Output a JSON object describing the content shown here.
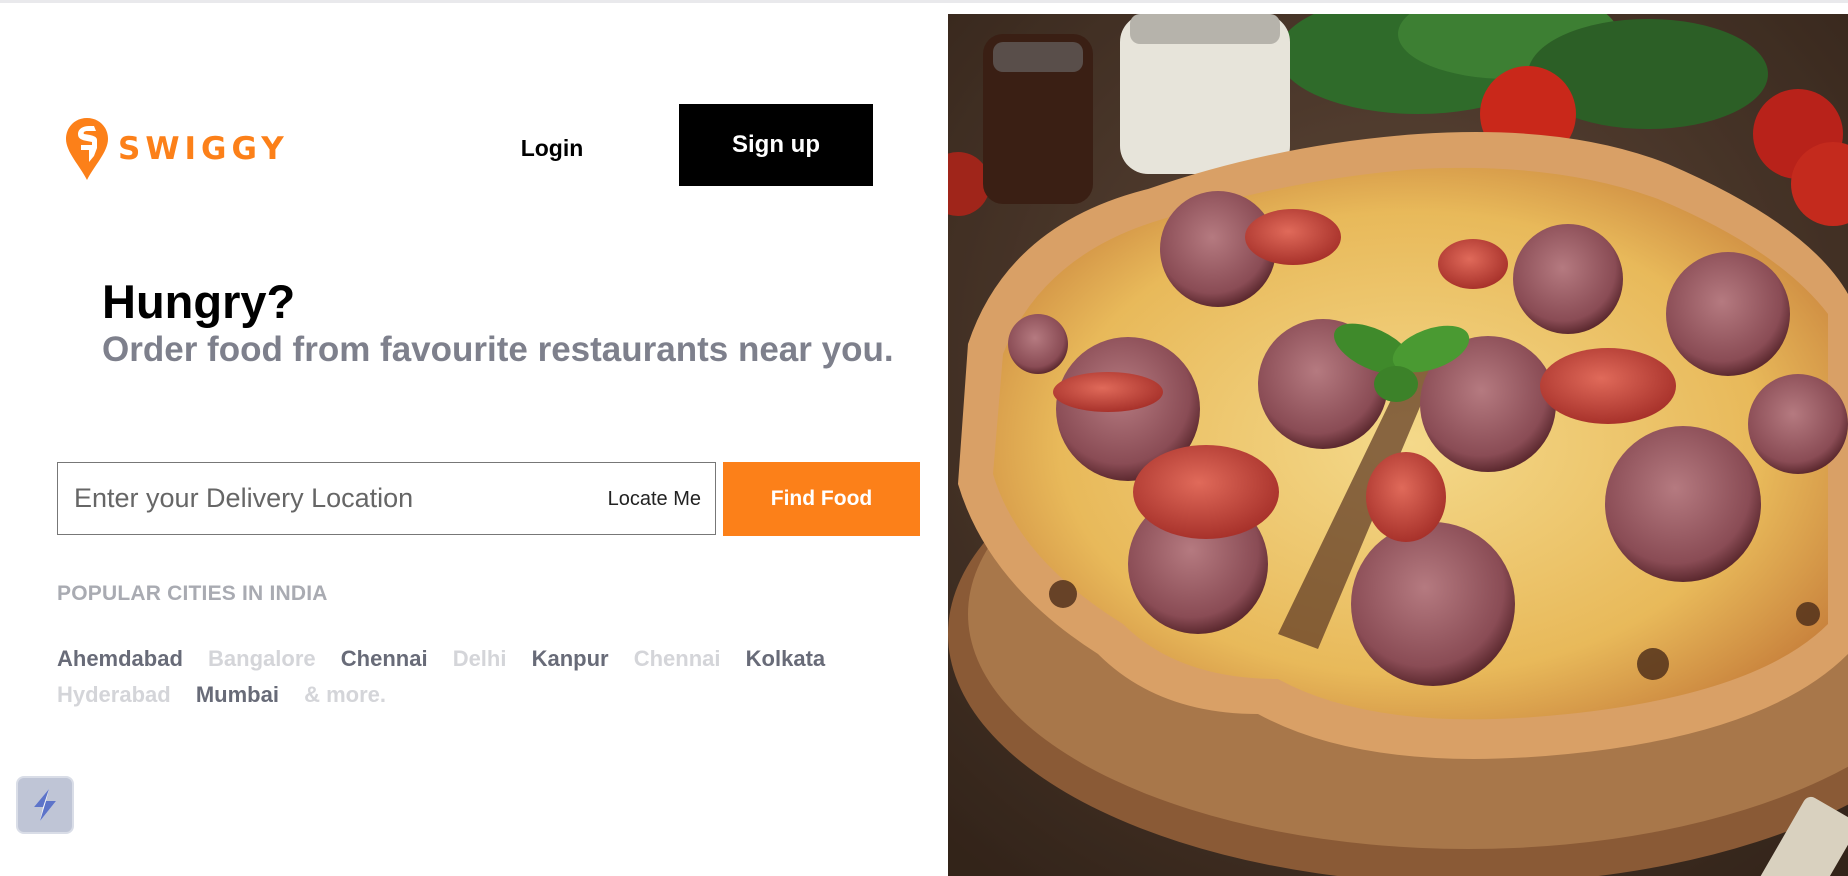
{
  "brand": {
    "name": "SWIGGY",
    "color": "#fc8019"
  },
  "header": {
    "login_label": "Login",
    "signup_label": "Sign up"
  },
  "hero_text": {
    "headline": "Hungry?",
    "subline": "Order food from favourite restaurants near you."
  },
  "search": {
    "placeholder": "Enter your Delivery Location",
    "value": "",
    "locate_label": "Locate Me",
    "submit_label": "Find Food"
  },
  "popular": {
    "title": "POPULAR CITIES IN INDIA",
    "cities": [
      {
        "name": "Ahemdabad",
        "tone": "dark"
      },
      {
        "name": "Bangalore",
        "tone": "light"
      },
      {
        "name": "Chennai",
        "tone": "dark"
      },
      {
        "name": "Delhi",
        "tone": "light"
      },
      {
        "name": "Kanpur",
        "tone": "dark"
      },
      {
        "name": "Chennai",
        "tone": "light"
      },
      {
        "name": "Kolkata",
        "tone": "dark"
      },
      {
        "name": "Hyderabad",
        "tone": "light"
      },
      {
        "name": "Mumbai",
        "tone": "dark"
      },
      {
        "name": "& more.",
        "tone": "light"
      }
    ]
  },
  "icons": {
    "logo": "swiggy-pin-logo-icon",
    "widget": "lightning-bolt-icon"
  },
  "hero_image": {
    "subject": "pepperoni-pizza-photo"
  }
}
